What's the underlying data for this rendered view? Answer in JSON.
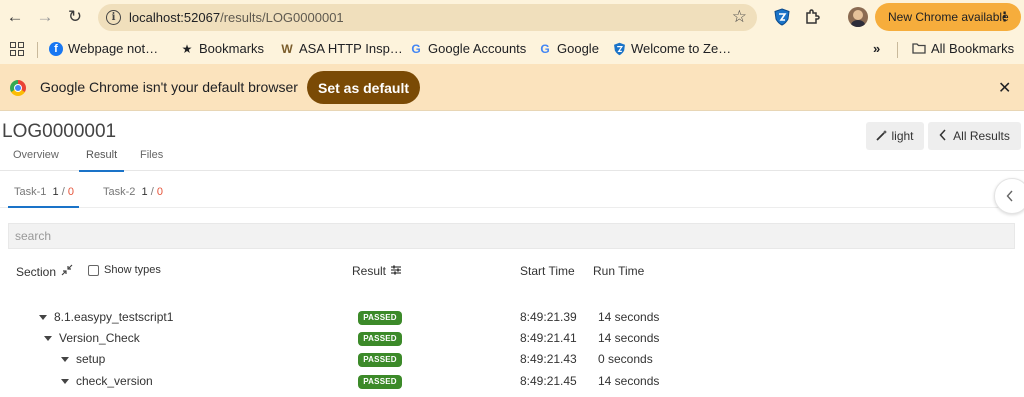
{
  "browser": {
    "url_host": "localhost:52067",
    "url_path": "/results/LOG0000001",
    "new_chrome_label": "New Chrome available",
    "more_label": "⋮"
  },
  "bookmarks": {
    "items": [
      {
        "label": "Webpage not…",
        "icon": "facebook-icon"
      },
      {
        "label": "Bookmarks",
        "icon": "star-icon"
      },
      {
        "label": "ASA HTTP Insp…",
        "icon": "w-icon"
      },
      {
        "label": "Google Accounts",
        "icon": "google-icon"
      },
      {
        "label": "Google",
        "icon": "google-icon"
      },
      {
        "label": "Welcome to Ze…",
        "icon": "shield-icon"
      }
    ],
    "overflow": "»",
    "all_bookmarks": "All Bookmarks"
  },
  "infobar": {
    "message": "Google Chrome isn't your default browser",
    "action": "Set as default",
    "close": "✕"
  },
  "page": {
    "title": "LOG0000001",
    "tabs": [
      "Overview",
      "Result",
      "Files"
    ],
    "active_tab": "Result",
    "light_label": "light",
    "all_results_label": "All Results",
    "subtabs": [
      {
        "label": "Task-1",
        "pass": "1",
        "fail": "0"
      },
      {
        "label": "Task-2",
        "pass": "1",
        "fail": "0"
      }
    ],
    "search_placeholder": "search"
  },
  "table": {
    "headers": {
      "section": "Section",
      "show_types": "Show types",
      "result": "Result",
      "start_time": "Start Time",
      "run_time": "Run Time"
    },
    "rows": [
      {
        "name": "8.1.easypy_testscript1",
        "result": "PASSED",
        "start": "8:49:21.39",
        "run": "14 seconds"
      },
      {
        "name": "Version_Check",
        "result": "PASSED",
        "start": "8:49:21.41",
        "run": "14 seconds"
      },
      {
        "name": "setup",
        "result": "PASSED",
        "start": "8:49:21.43",
        "run": "0 seconds"
      },
      {
        "name": "check_version",
        "result": "PASSED",
        "start": "8:49:21.45",
        "run": "14 seconds"
      }
    ]
  },
  "colors": {
    "browser_bg": "#fdf3dc",
    "infobar_bg": "#fbe3bd",
    "set_default_bg": "#7a4a05",
    "passed_badge": "#3c8a29",
    "active_tab_underline": "#1a73c8",
    "fail_count": "#e5543a"
  }
}
